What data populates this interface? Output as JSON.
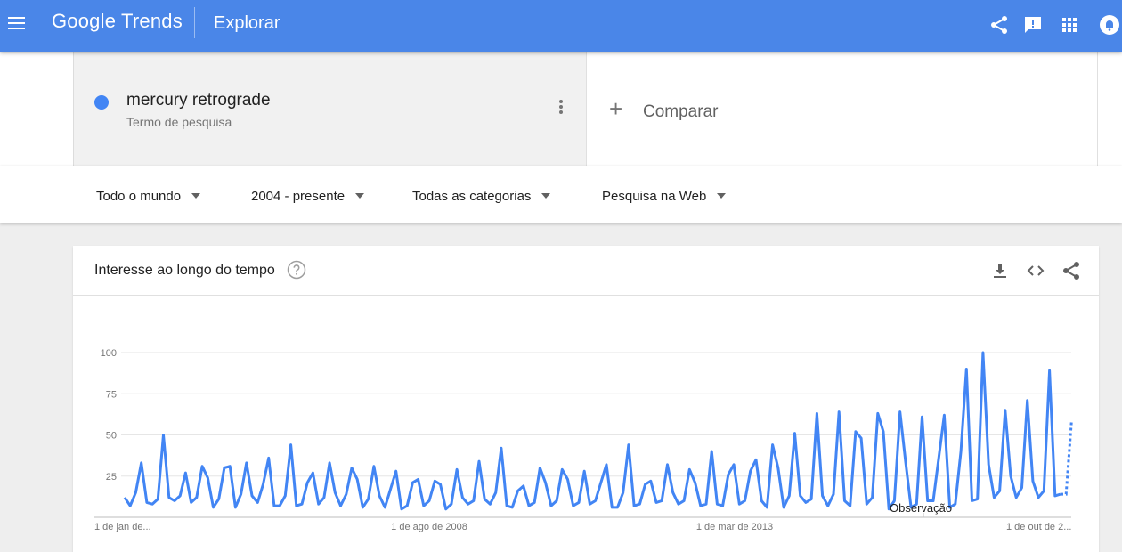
{
  "header": {
    "logo": "Google Trends",
    "section_title": "Explorar",
    "icons": [
      "menu-icon",
      "share-icon",
      "feedback-icon",
      "apps-icon",
      "notifications-icon"
    ],
    "colors": {
      "topbar": "#4a86e8"
    }
  },
  "search": {
    "term": "mercury retrograde",
    "term_type": "Termo de pesquisa",
    "term_color": "#4285f4",
    "compare_label": "Comparar"
  },
  "filters": {
    "region": "Todo o mundo",
    "period": "2004 - presente",
    "category": "Todas as categorias",
    "search_type": "Pesquisa na Web"
  },
  "interest_card": {
    "title": "Interesse ao longo do tempo",
    "icons": [
      "help-icon",
      "download-icon",
      "embed-icon",
      "share-icon"
    ]
  },
  "chart_data": {
    "type": "line",
    "title": "Interesse ao longo do tempo",
    "y_ticks": [
      25,
      50,
      75,
      100
    ],
    "ylim": [
      0,
      100
    ],
    "x_tick_labels": [
      "1 de jan de...",
      "1 de ago de 2008",
      "1 de mar de 2013",
      "1 de out de 2..."
    ],
    "annotation": "Observação",
    "grid": true,
    "series": [
      {
        "color": "#4285f4",
        "values": [
          12,
          7,
          15,
          33,
          9,
          8,
          11,
          50,
          12,
          10,
          13,
          27,
          9,
          12,
          31,
          24,
          6,
          11,
          30,
          31,
          6,
          14,
          33,
          13,
          9,
          20,
          36,
          7,
          7,
          13,
          44,
          7,
          8,
          21,
          27,
          8,
          12,
          33,
          15,
          7,
          14,
          30,
          23,
          6,
          11,
          31,
          13,
          6,
          17,
          28,
          5,
          7,
          21,
          23,
          7,
          10,
          22,
          20,
          5,
          8,
          29,
          12,
          8,
          10,
          34,
          11,
          8,
          15,
          42,
          7,
          6,
          16,
          19,
          7,
          9,
          30,
          21,
          7,
          10,
          29,
          23,
          7,
          9,
          28,
          8,
          10,
          21,
          32,
          6,
          6,
          15,
          44,
          7,
          8,
          20,
          22,
          9,
          10,
          32,
          15,
          8,
          10,
          29,
          21,
          7,
          8,
          40,
          8,
          7,
          26,
          32,
          8,
          10,
          28,
          35,
          10,
          6,
          44,
          30,
          6,
          13,
          51,
          13,
          9,
          11,
          63,
          13,
          7,
          14,
          64,
          10,
          7,
          52,
          48,
          8,
          12,
          63,
          52,
          5,
          10,
          64,
          34,
          6,
          8,
          61,
          10,
          10,
          36,
          62,
          6,
          8,
          40,
          90,
          10,
          11,
          100,
          32,
          12,
          16,
          65,
          25,
          12,
          18,
          71,
          22,
          12,
          16,
          89,
          13,
          14
        ],
        "partial_values": [
          14,
          59
        ]
      }
    ]
  }
}
